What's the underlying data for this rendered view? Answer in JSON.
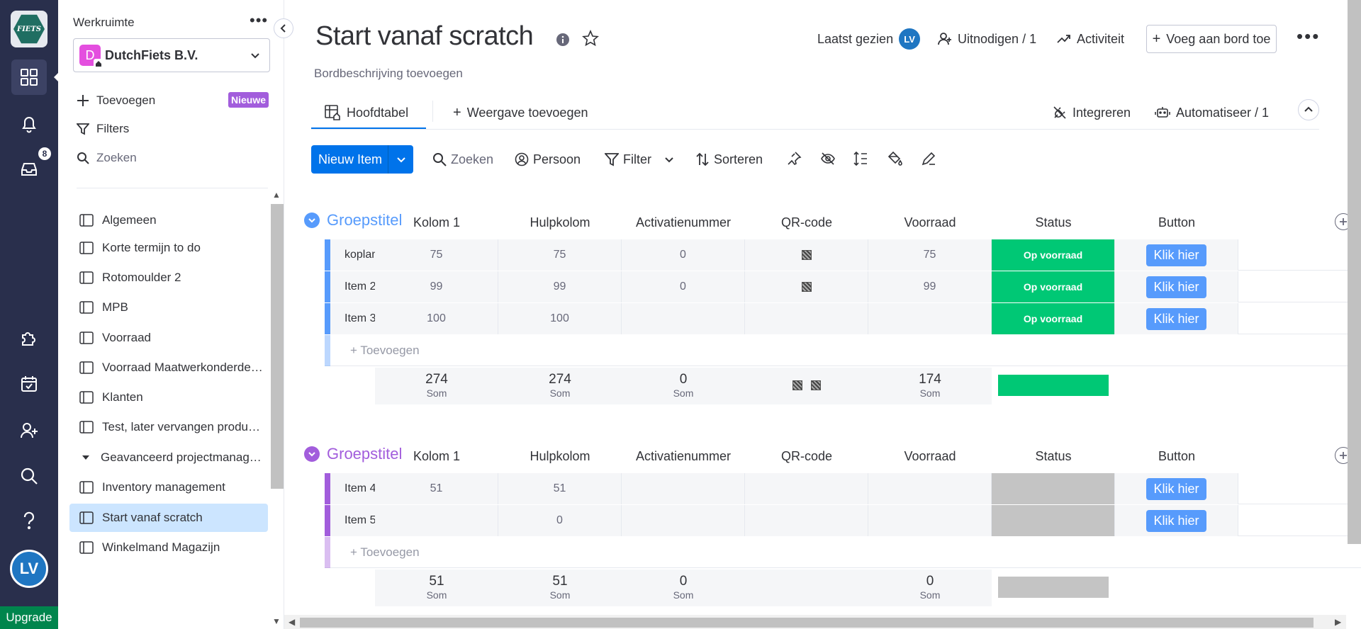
{
  "rail": {
    "logo_text": "FIETS",
    "inbox_badge": "8",
    "avatar_initials": "LV",
    "upgrade_label": "Upgrade"
  },
  "sidebar": {
    "workspace_label": "Werkruimte",
    "workspace_initial": "D",
    "workspace_name": "DutchFiets B.V.",
    "add_label": "Toevoegen",
    "new_badge": "Nieuwe",
    "filters_label": "Filters",
    "search_placeholder": "Zoeken",
    "boards": [
      {
        "label": "Algemeen"
      },
      {
        "label": "Korte termijn to do"
      },
      {
        "label": "Rotomoulder 2"
      },
      {
        "label": "MPB"
      },
      {
        "label": "Voorraad"
      },
      {
        "label": "Voorraad Maatwerkonderdelen"
      },
      {
        "label": "Klanten"
      },
      {
        "label": "Test, later vervangen producten"
      },
      {
        "label": "Geavanceerd projectmanagement"
      },
      {
        "label": "Inventory management"
      },
      {
        "label": "Start vanaf scratch"
      },
      {
        "label": "Winkelmand Magazijn"
      }
    ]
  },
  "header": {
    "title": "Start vanaf scratch",
    "description": "Bordbeschrijving toevoegen",
    "last_seen": "Laatst gezien",
    "last_seen_initials": "LV",
    "invite": "Uitnodigen / 1",
    "activity": "Activiteit",
    "add_to_board": "Voeg aan bord toe"
  },
  "tabs": {
    "main_table": "Hoofdtabel",
    "add_view": "Weergave toevoegen",
    "integrate": "Integreren",
    "automate": "Automatiseer / 1"
  },
  "toolbar": {
    "new_item": "Nieuw Item",
    "search": "Zoeken",
    "person": "Persoon",
    "filter": "Filter",
    "sort": "Sorteren"
  },
  "columns": [
    "Kolom 1",
    "Hulpkolom",
    "Activatienummer",
    "QR-code",
    "Voorraad",
    "Status",
    "Button"
  ],
  "colors": {
    "group1": "#579bfc",
    "group2": "#a25ddc",
    "status_done": "#00c875",
    "status_empty": "#c4c4c4",
    "primary": "#0073ea"
  },
  "groups": [
    {
      "title": "Groepstitel",
      "items": [
        {
          "name": "koplamp",
          "kolom1": "75",
          "hulp": "75",
          "activatie": "0",
          "qr": true,
          "voorraad": "75",
          "status": "Op voorraad",
          "button": "Klik hier"
        },
        {
          "name": "Item 2",
          "kolom1": "99",
          "hulp": "99",
          "activatie": "0",
          "qr": true,
          "voorraad": "99",
          "status": "Op voorraad",
          "button": "Klik hier"
        },
        {
          "name": "Item 3",
          "kolom1": "100",
          "hulp": "100",
          "activatie": "",
          "qr": false,
          "voorraad": "",
          "status": "Op voorraad",
          "button": "Klik hier"
        }
      ],
      "add_label": "+ Toevoegen",
      "summary": {
        "kolom1": "274",
        "hulp": "274",
        "activatie": "0",
        "voorraad": "174",
        "label": "Som"
      }
    },
    {
      "title": "Groepstitel",
      "items": [
        {
          "name": "Item 4",
          "kolom1": "51",
          "hulp": "51",
          "activatie": "",
          "qr": false,
          "voorraad": "",
          "status": "",
          "button": "Klik hier"
        },
        {
          "name": "Item 5",
          "kolom1": "",
          "hulp": "0",
          "activatie": "",
          "qr": false,
          "voorraad": "",
          "status": "",
          "button": "Klik hier"
        }
      ],
      "add_label": "+ Toevoegen",
      "summary": {
        "kolom1": "51",
        "hulp": "51",
        "activatie": "0",
        "voorraad": "0",
        "label": "Som"
      }
    }
  ]
}
